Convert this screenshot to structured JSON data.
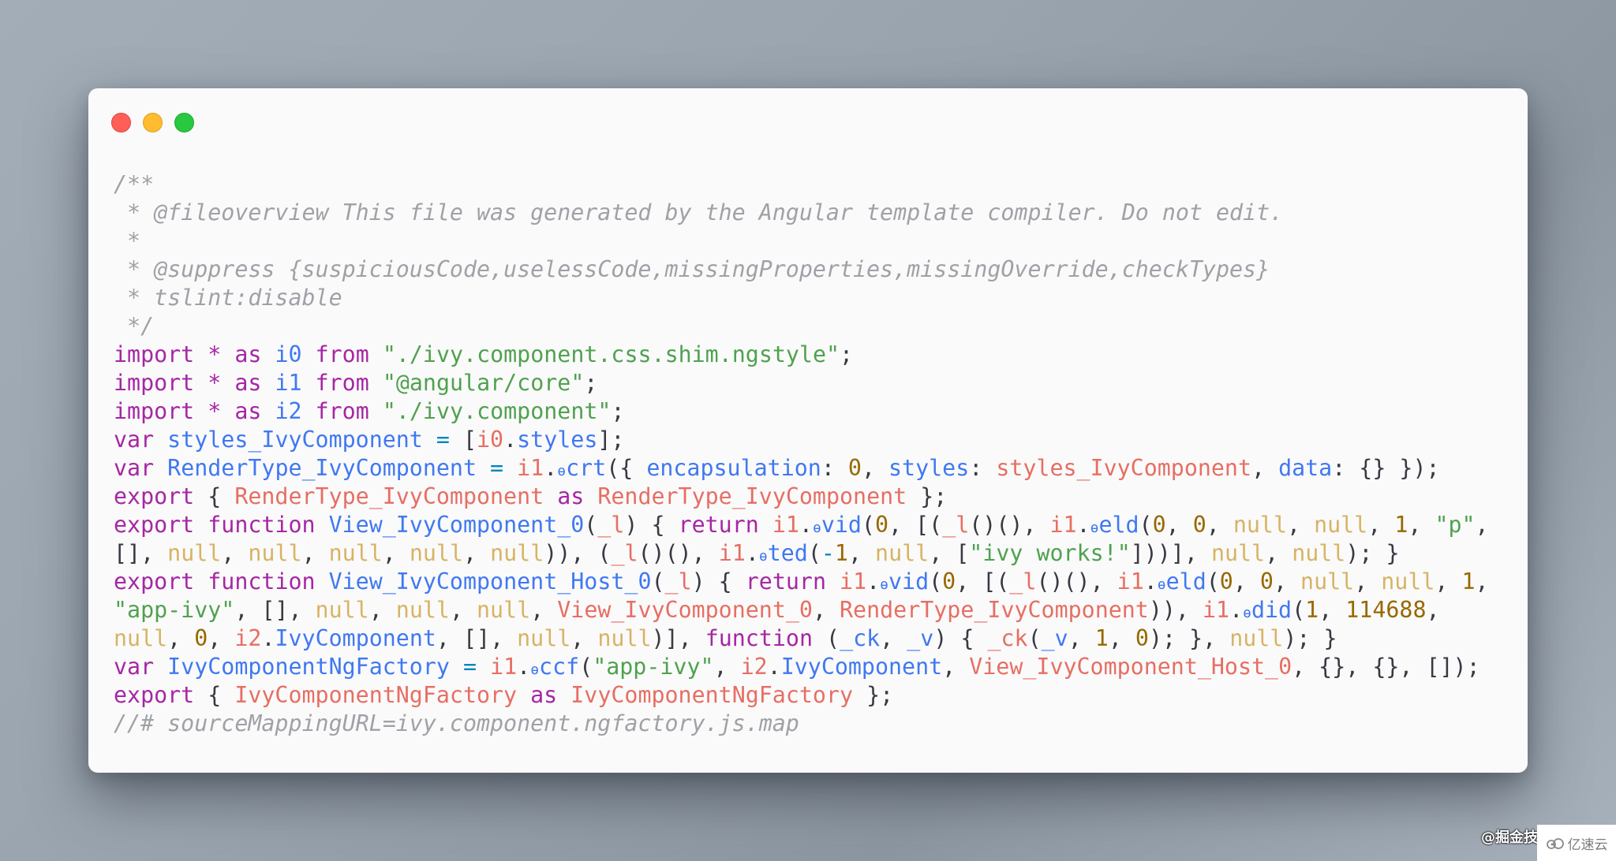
{
  "window": {
    "traffic_lights": [
      {
        "name": "close",
        "color": "#ff5f57"
      },
      {
        "name": "minimize",
        "color": "#febc2e"
      },
      {
        "name": "maximize",
        "color": "#28c840"
      }
    ]
  },
  "code": {
    "language": "javascript",
    "theme_colors": {
      "comment": "#a0a1a7",
      "keyword": "#a626a4",
      "string": "#50a14f",
      "identifier": "#4078f2",
      "variable": "#e45649",
      "number": "#986801",
      "null": "#c18401",
      "punctuation": "#383a42"
    },
    "lines": [
      [
        [
          "comment",
          "/**"
        ]
      ],
      [
        [
          "comment",
          " * @fileoverview This file was generated by the Angular template compiler. Do not edit."
        ]
      ],
      [
        [
          "comment",
          " *"
        ]
      ],
      [
        [
          "comment",
          " * @suppress {suspiciousCode,uselessCode,missingProperties,missingOverride,checkTypes}"
        ]
      ],
      [
        [
          "comment",
          " * tslint:disable"
        ]
      ],
      [
        [
          "comment",
          " */"
        ]
      ],
      [
        [
          "keyword",
          "import"
        ],
        [
          "punct",
          " "
        ],
        [
          "keyword",
          "*"
        ],
        [
          "punct",
          " "
        ],
        [
          "keyword",
          "as"
        ],
        [
          "punct",
          " "
        ],
        [
          "ident",
          "i0"
        ],
        [
          "punct",
          " "
        ],
        [
          "keyword",
          "from"
        ],
        [
          "punct",
          " "
        ],
        [
          "string",
          "\"./ivy.component.css.shim.ngstyle\""
        ],
        [
          "punct",
          ";"
        ]
      ],
      [
        [
          "keyword",
          "import"
        ],
        [
          "punct",
          " "
        ],
        [
          "keyword",
          "*"
        ],
        [
          "punct",
          " "
        ],
        [
          "keyword",
          "as"
        ],
        [
          "punct",
          " "
        ],
        [
          "ident",
          "i1"
        ],
        [
          "punct",
          " "
        ],
        [
          "keyword",
          "from"
        ],
        [
          "punct",
          " "
        ],
        [
          "string",
          "\"@angular/core\""
        ],
        [
          "punct",
          ";"
        ]
      ],
      [
        [
          "keyword",
          "import"
        ],
        [
          "punct",
          " "
        ],
        [
          "keyword",
          "*"
        ],
        [
          "punct",
          " "
        ],
        [
          "keyword",
          "as"
        ],
        [
          "punct",
          " "
        ],
        [
          "ident",
          "i2"
        ],
        [
          "punct",
          " "
        ],
        [
          "keyword",
          "from"
        ],
        [
          "punct",
          " "
        ],
        [
          "string",
          "\"./ivy.component\""
        ],
        [
          "punct",
          ";"
        ]
      ],
      [
        [
          "keyword",
          "var"
        ],
        [
          "punct",
          " "
        ],
        [
          "ident",
          "styles_IvyComponent"
        ],
        [
          "punct",
          " "
        ],
        [
          "op",
          "="
        ],
        [
          "punct",
          " ["
        ],
        [
          "var",
          "i0"
        ],
        [
          "punct",
          "."
        ],
        [
          "ident",
          "styles"
        ],
        [
          "punct",
          "];"
        ]
      ],
      [
        [
          "keyword",
          "var"
        ],
        [
          "punct",
          " "
        ],
        [
          "ident",
          "RenderType_IvyComponent"
        ],
        [
          "punct",
          " "
        ],
        [
          "op",
          "="
        ],
        [
          "punct",
          " "
        ],
        [
          "var",
          "i1"
        ],
        [
          "punct",
          "."
        ],
        [
          "theta",
          "ɵ"
        ],
        [
          "ident",
          "crt"
        ],
        [
          "punct",
          "({ "
        ],
        [
          "ident",
          "encapsulation"
        ],
        [
          "punct",
          ": "
        ],
        [
          "number",
          "0"
        ],
        [
          "punct",
          ", "
        ],
        [
          "ident",
          "styles"
        ],
        [
          "punct",
          ": "
        ],
        [
          "var",
          "styles_IvyComponent"
        ],
        [
          "punct",
          ", "
        ],
        [
          "ident",
          "data"
        ],
        [
          "punct",
          ": {} });"
        ]
      ],
      [
        [
          "keyword",
          "export"
        ],
        [
          "punct",
          " { "
        ],
        [
          "var",
          "RenderType_IvyComponent"
        ],
        [
          "punct",
          " "
        ],
        [
          "keyword",
          "as"
        ],
        [
          "punct",
          " "
        ],
        [
          "var",
          "RenderType_IvyComponent"
        ],
        [
          "punct",
          " };"
        ]
      ],
      [
        [
          "keyword",
          "export"
        ],
        [
          "punct",
          " "
        ],
        [
          "keyword",
          "function"
        ],
        [
          "punct",
          " "
        ],
        [
          "ident",
          "View_IvyComponent_0"
        ],
        [
          "punct",
          "("
        ],
        [
          "var",
          "_l"
        ],
        [
          "punct",
          ") { "
        ],
        [
          "keyword",
          "return"
        ],
        [
          "punct",
          " "
        ],
        [
          "var",
          "i1"
        ],
        [
          "punct",
          "."
        ],
        [
          "theta",
          "ɵ"
        ],
        [
          "ident",
          "vid"
        ],
        [
          "punct",
          "("
        ],
        [
          "number",
          "0"
        ],
        [
          "punct",
          ", [("
        ],
        [
          "var",
          "_l"
        ],
        [
          "punct",
          "()(), "
        ],
        [
          "var",
          "i1"
        ],
        [
          "punct",
          "."
        ],
        [
          "theta",
          "ɵ"
        ],
        [
          "ident",
          "eld"
        ],
        [
          "punct",
          "("
        ],
        [
          "number",
          "0"
        ],
        [
          "punct",
          ", "
        ],
        [
          "number",
          "0"
        ],
        [
          "punct",
          ", "
        ],
        [
          "null",
          "null"
        ],
        [
          "punct",
          ", "
        ],
        [
          "null",
          "null"
        ],
        [
          "punct",
          ", "
        ],
        [
          "number",
          "1"
        ],
        [
          "punct",
          ", "
        ],
        [
          "string",
          "\"p\""
        ],
        [
          "punct",
          ","
        ]
      ],
      [
        [
          "punct",
          "[], "
        ],
        [
          "null",
          "null"
        ],
        [
          "punct",
          ", "
        ],
        [
          "null",
          "null"
        ],
        [
          "punct",
          ", "
        ],
        [
          "null",
          "null"
        ],
        [
          "punct",
          ", "
        ],
        [
          "null",
          "null"
        ],
        [
          "punct",
          ", "
        ],
        [
          "null",
          "null"
        ],
        [
          "punct",
          ")), ("
        ],
        [
          "var",
          "_l"
        ],
        [
          "punct",
          "()(), "
        ],
        [
          "var",
          "i1"
        ],
        [
          "punct",
          "."
        ],
        [
          "theta",
          "ɵ"
        ],
        [
          "ident",
          "ted"
        ],
        [
          "punct",
          "("
        ],
        [
          "op",
          "-"
        ],
        [
          "number",
          "1"
        ],
        [
          "punct",
          ", "
        ],
        [
          "null",
          "null"
        ],
        [
          "punct",
          ", ["
        ],
        [
          "string",
          "\"ivy works!\""
        ],
        [
          "punct",
          "]))], "
        ],
        [
          "null",
          "null"
        ],
        [
          "punct",
          ", "
        ],
        [
          "null",
          "null"
        ],
        [
          "punct",
          "); }"
        ]
      ],
      [
        [
          "keyword",
          "export"
        ],
        [
          "punct",
          " "
        ],
        [
          "keyword",
          "function"
        ],
        [
          "punct",
          " "
        ],
        [
          "ident",
          "View_IvyComponent_Host_0"
        ],
        [
          "punct",
          "("
        ],
        [
          "var",
          "_l"
        ],
        [
          "punct",
          ") { "
        ],
        [
          "keyword",
          "return"
        ],
        [
          "punct",
          " "
        ],
        [
          "var",
          "i1"
        ],
        [
          "punct",
          "."
        ],
        [
          "theta",
          "ɵ"
        ],
        [
          "ident",
          "vid"
        ],
        [
          "punct",
          "("
        ],
        [
          "number",
          "0"
        ],
        [
          "punct",
          ", [("
        ],
        [
          "var",
          "_l"
        ],
        [
          "punct",
          "()(), "
        ],
        [
          "var",
          "i1"
        ],
        [
          "punct",
          "."
        ],
        [
          "theta",
          "ɵ"
        ],
        [
          "ident",
          "eld"
        ],
        [
          "punct",
          "("
        ],
        [
          "number",
          "0"
        ],
        [
          "punct",
          ", "
        ],
        [
          "number",
          "0"
        ],
        [
          "punct",
          ", "
        ],
        [
          "null",
          "null"
        ],
        [
          "punct",
          ", "
        ],
        [
          "null",
          "null"
        ],
        [
          "punct",
          ", "
        ],
        [
          "number",
          "1"
        ],
        [
          "punct",
          ","
        ]
      ],
      [
        [
          "string",
          "\"app-ivy\""
        ],
        [
          "punct",
          ", [], "
        ],
        [
          "null",
          "null"
        ],
        [
          "punct",
          ", "
        ],
        [
          "null",
          "null"
        ],
        [
          "punct",
          ", "
        ],
        [
          "null",
          "null"
        ],
        [
          "punct",
          ", "
        ],
        [
          "var",
          "View_IvyComponent_0"
        ],
        [
          "punct",
          ", "
        ],
        [
          "var",
          "RenderType_IvyComponent"
        ],
        [
          "punct",
          ")), "
        ],
        [
          "var",
          "i1"
        ],
        [
          "punct",
          "."
        ],
        [
          "theta",
          "ɵ"
        ],
        [
          "ident",
          "did"
        ],
        [
          "punct",
          "("
        ],
        [
          "number",
          "1"
        ],
        [
          "punct",
          ", "
        ],
        [
          "number",
          "114688"
        ],
        [
          "punct",
          ","
        ]
      ],
      [
        [
          "null",
          "null"
        ],
        [
          "punct",
          ", "
        ],
        [
          "number",
          "0"
        ],
        [
          "punct",
          ", "
        ],
        [
          "var",
          "i2"
        ],
        [
          "punct",
          "."
        ],
        [
          "ident",
          "IvyComponent"
        ],
        [
          "punct",
          ", [], "
        ],
        [
          "null",
          "null"
        ],
        [
          "punct",
          ", "
        ],
        [
          "null",
          "null"
        ],
        [
          "punct",
          ")], "
        ],
        [
          "keyword",
          "function"
        ],
        [
          "punct",
          " ("
        ],
        [
          "ident",
          "_ck"
        ],
        [
          "punct",
          ", "
        ],
        [
          "ident",
          "_v"
        ],
        [
          "punct",
          ") { "
        ],
        [
          "var",
          "_ck"
        ],
        [
          "punct",
          "("
        ],
        [
          "ident",
          "_v"
        ],
        [
          "punct",
          ", "
        ],
        [
          "number",
          "1"
        ],
        [
          "punct",
          ", "
        ],
        [
          "number",
          "0"
        ],
        [
          "punct",
          "); }, "
        ],
        [
          "null",
          "null"
        ],
        [
          "punct",
          "); }"
        ]
      ],
      [
        [
          "keyword",
          "var"
        ],
        [
          "punct",
          " "
        ],
        [
          "ident",
          "IvyComponentNgFactory"
        ],
        [
          "punct",
          " "
        ],
        [
          "op",
          "="
        ],
        [
          "punct",
          " "
        ],
        [
          "var",
          "i1"
        ],
        [
          "punct",
          "."
        ],
        [
          "theta",
          "ɵ"
        ],
        [
          "ident",
          "ccf"
        ],
        [
          "punct",
          "("
        ],
        [
          "string",
          "\"app-ivy\""
        ],
        [
          "punct",
          ", "
        ],
        [
          "var",
          "i2"
        ],
        [
          "punct",
          "."
        ],
        [
          "ident",
          "IvyComponent"
        ],
        [
          "punct",
          ", "
        ],
        [
          "var",
          "View_IvyComponent_Host_0"
        ],
        [
          "punct",
          ", {}, {}, []);"
        ]
      ],
      [
        [
          "keyword",
          "export"
        ],
        [
          "punct",
          " { "
        ],
        [
          "var",
          "IvyComponentNgFactory"
        ],
        [
          "punct",
          " "
        ],
        [
          "keyword",
          "as"
        ],
        [
          "punct",
          " "
        ],
        [
          "var",
          "IvyComponentNgFactory"
        ],
        [
          "punct",
          " };"
        ]
      ],
      [
        [
          "comment",
          "//# sourceMappingURL=ivy.component.ngfactory.js.map"
        ]
      ]
    ]
  },
  "watermarks": {
    "juejin": "@掘金技",
    "yisu": "亿速云",
    "yisu_icon": "cloud-logo-icon"
  }
}
